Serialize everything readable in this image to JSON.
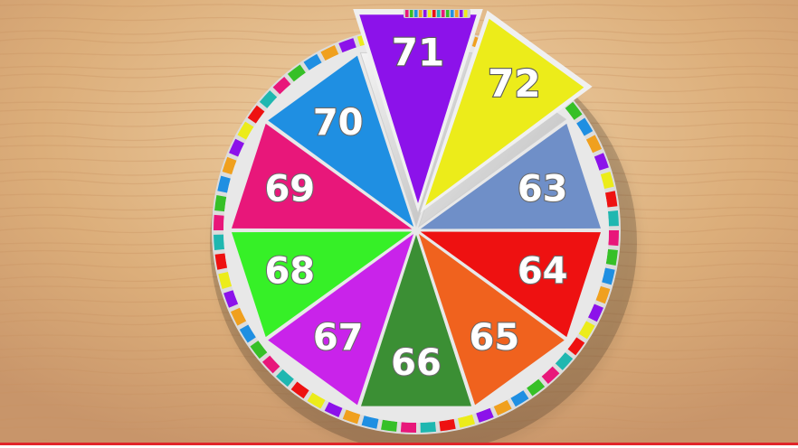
{
  "wheel": {
    "segments": [
      {
        "label": "63",
        "color": "#6f8fc8"
      },
      {
        "label": "64",
        "color": "#ee1111"
      },
      {
        "label": "65",
        "color": "#f0621e"
      },
      {
        "label": "66",
        "color": "#3b8f34"
      },
      {
        "label": "67",
        "color": "#c923ea"
      },
      {
        "label": "68",
        "color": "#36f027"
      },
      {
        "label": "69",
        "color": "#e8177a"
      },
      {
        "label": "70",
        "color": "#1f8fe2"
      },
      {
        "label": "71",
        "color": "#8c12ea"
      },
      {
        "label": "72",
        "color": "#ecec1a"
      }
    ],
    "raised_segments": [
      "71",
      "72"
    ]
  },
  "colors": {
    "wood": "#d9ac78",
    "rim_palette": [
      "#e8177a",
      "#36c027",
      "#1f8fe2",
      "#f0a01e",
      "#8c12ea",
      "#ecec1a",
      "#ee1111",
      "#1fb7b0"
    ],
    "divider": "#e8e8e8",
    "progress_bar": "#e0262a"
  }
}
